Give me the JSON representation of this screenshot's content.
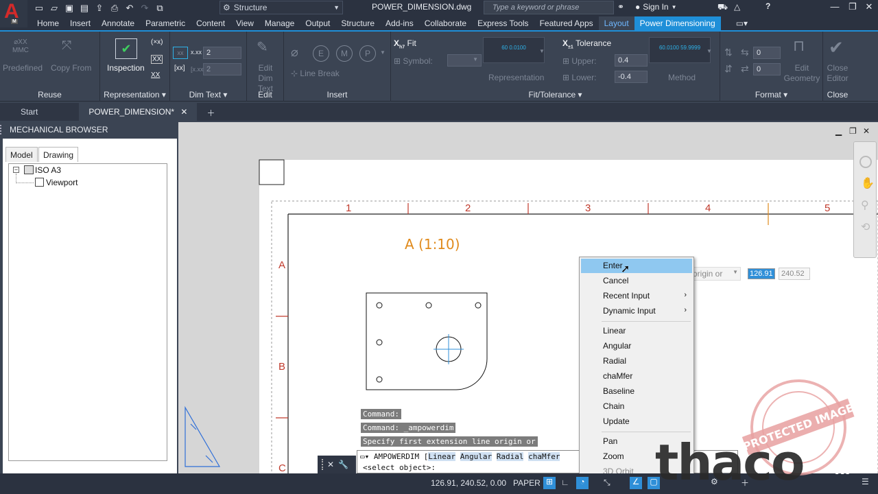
{
  "titlebar": {
    "workspace": "Structure",
    "filename": "POWER_DIMENSION.dwg",
    "search_placeholder": "Type a keyword or phrase",
    "sign_in": "Sign In",
    "app_letter": "A",
    "app_badge": "M"
  },
  "ribbon_tabs": [
    "Home",
    "Insert",
    "Annotate",
    "Parametric",
    "Content",
    "View",
    "Manage",
    "Output",
    "Structure",
    "Add-ins",
    "Collaborate",
    "Express Tools",
    "Featured Apps",
    "Layout",
    "Power Dimensioning"
  ],
  "ribbon": {
    "reuse": {
      "title": "Reuse",
      "predefined": "Predefined",
      "copy_from": "Copy From"
    },
    "representation": {
      "title": "Representation",
      "inspection": "Inspection"
    },
    "dimtext": {
      "title": "Dim Text",
      "value1": "2",
      "value2": "2"
    },
    "edit": {
      "title": "Edit",
      "edit_dim_text_l1": "Edit",
      "edit_dim_text_l2": "Dim Text"
    },
    "insert": {
      "title": "Insert",
      "line_break": "Line Break"
    },
    "fit": {
      "title": "Fit/Tolerance",
      "fit_label": "Fit",
      "symbol_label": "Symbol:",
      "representation_label": "Representation",
      "tolerance_label": "Tolerance",
      "upper_label": "Upper:",
      "lower_label": "Lower:",
      "upper": "0.4",
      "lower": "-0.4",
      "method_label": "Method",
      "preview_rep": "60 0.0100",
      "preview_method": "60.0100 59.9999"
    },
    "format": {
      "title": "Format",
      "v1": "0",
      "v2": "0",
      "edit_geometry_l1": "Edit",
      "edit_geometry_l2": "Geometry"
    },
    "close": {
      "title": "Close",
      "close_editor_l1": "Close",
      "close_editor_l2": "Editor"
    }
  },
  "doc_tabs": {
    "start": "Start",
    "active": "POWER_DIMENSION*"
  },
  "browser": {
    "title": "MECHANICAL BROWSER",
    "tabs": [
      "Model",
      "Drawing"
    ],
    "tree_root": "ISO A3",
    "tree_child": "Viewport"
  },
  "drawing": {
    "col_labels": [
      "1",
      "2",
      "3",
      "4",
      "5"
    ],
    "row_labels": [
      "A",
      "B",
      "C"
    ],
    "view_label": "A (1:10)"
  },
  "dynamic_input": {
    "prompt": "origin or",
    "x": "126.91",
    "y": "240.52"
  },
  "context_menu": {
    "items": [
      "Enter",
      "Cancel",
      "Recent Input",
      "Dynamic Input",
      "Linear",
      "Angular",
      "Radial",
      "chaMfer",
      "Baseline",
      "Chain",
      "Update",
      "Pan",
      "Zoom",
      "3D Orbit"
    ]
  },
  "command": {
    "history": [
      "Command:",
      "Command: _ampowerdim",
      "Specify first extension line origin or"
    ],
    "current": "AMPOWERDIM [",
    "options": [
      "Linear",
      "Angular",
      "Radial",
      "chaMfer"
    ],
    "second_line": "<select object>:"
  },
  "status": {
    "coords": "126.91, 240.52, 0.00",
    "space": "PAPER"
  },
  "watermark": {
    "brand": "thaco",
    "tld": ".ir",
    "stamp": "PROTECTED IMAGE"
  },
  "colors": {
    "accent": "#1f8fd8",
    "highlight": "#8fc8f0",
    "drawing_red": "#c0392b",
    "view_label": "#e08a1c"
  }
}
